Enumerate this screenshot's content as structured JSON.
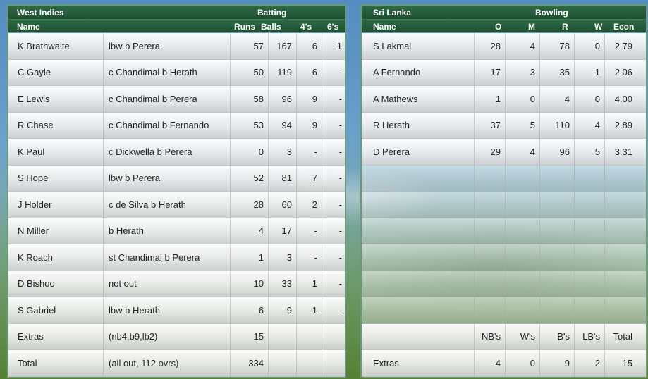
{
  "batting": {
    "team": "West Indies",
    "section_title": "Batting",
    "columns": {
      "name": "Name",
      "runs": "Runs",
      "balls": "Balls",
      "fours": "4's",
      "sixes": "6's"
    },
    "rows": [
      {
        "name": "K Brathwaite",
        "dismissal": "lbw b Perera",
        "runs": "57",
        "balls": "167",
        "fours": "6",
        "sixes": "1"
      },
      {
        "name": "C Gayle",
        "dismissal": "c Chandimal b Herath",
        "runs": "50",
        "balls": "119",
        "fours": "6",
        "sixes": "-"
      },
      {
        "name": "E Lewis",
        "dismissal": "c Chandimal b Perera",
        "runs": "58",
        "balls": "96",
        "fours": "9",
        "sixes": "-"
      },
      {
        "name": "R Chase",
        "dismissal": "c Chandimal b Fernando",
        "runs": "53",
        "balls": "94",
        "fours": "9",
        "sixes": "-"
      },
      {
        "name": "K Paul",
        "dismissal": "c Dickwella b Perera",
        "runs": "0",
        "balls": "3",
        "fours": "-",
        "sixes": "-"
      },
      {
        "name": "S Hope",
        "dismissal": "lbw b Perera",
        "runs": "52",
        "balls": "81",
        "fours": "7",
        "sixes": "-"
      },
      {
        "name": "J Holder",
        "dismissal": "c de Silva b Herath",
        "runs": "28",
        "balls": "60",
        "fours": "2",
        "sixes": "-"
      },
      {
        "name": "N Miller",
        "dismissal": "b Herath",
        "runs": "4",
        "balls": "17",
        "fours": "-",
        "sixes": "-"
      },
      {
        "name": "K Roach",
        "dismissal": "st Chandimal b Perera",
        "runs": "1",
        "balls": "3",
        "fours": "-",
        "sixes": "-"
      },
      {
        "name": "D Bishoo",
        "dismissal": "not out",
        "runs": "10",
        "balls": "33",
        "fours": "1",
        "sixes": "-"
      },
      {
        "name": "S Gabriel",
        "dismissal": "lbw b Herath",
        "runs": "6",
        "balls": "9",
        "fours": "1",
        "sixes": "-"
      }
    ],
    "extras": {
      "label": "Extras",
      "detail": "(nb4,b9,lb2)",
      "value": "15"
    },
    "total": {
      "label": "Total",
      "detail": "(all out, 112 ovrs)",
      "value": "334"
    }
  },
  "bowling": {
    "team": "Sri Lanka",
    "section_title": "Bowling",
    "columns": {
      "name": "Name",
      "overs": "O",
      "maidens": "M",
      "runs": "R",
      "wickets": "W",
      "econ": "Econ"
    },
    "rows": [
      {
        "name": "S Lakmal",
        "overs": "28",
        "maidens": "4",
        "runs": "78",
        "wickets": "0",
        "econ": "2.79"
      },
      {
        "name": "A Fernando",
        "overs": "17",
        "maidens": "3",
        "runs": "35",
        "wickets": "1",
        "econ": "2.06"
      },
      {
        "name": "A Mathews",
        "overs": "1",
        "maidens": "0",
        "runs": "4",
        "wickets": "0",
        "econ": "4.00"
      },
      {
        "name": "R Herath",
        "overs": "37",
        "maidens": "5",
        "runs": "110",
        "wickets": "4",
        "econ": "2.89"
      },
      {
        "name": "D Perera",
        "overs": "29",
        "maidens": "4",
        "runs": "96",
        "wickets": "5",
        "econ": "3.31"
      }
    ],
    "extras_header": {
      "nb": "NB's",
      "w": "W's",
      "b": "B's",
      "lb": "LB's",
      "total": "Total"
    },
    "extras": {
      "label": "Extras",
      "nb": "4",
      "w": "0",
      "b": "9",
      "lb": "2",
      "total": "15"
    }
  }
}
